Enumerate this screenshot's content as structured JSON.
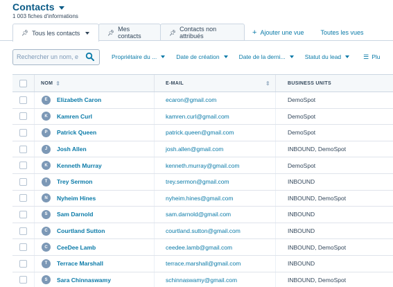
{
  "header": {
    "title": "Contacts",
    "subtitle": "1 003 fiches d'informations"
  },
  "tabs": [
    {
      "label": "Tous les contacts",
      "active": true
    },
    {
      "label": "Mes contacts",
      "active": false
    },
    {
      "label": "Contacts non attribués",
      "active": false
    }
  ],
  "tab_links": {
    "add_view": "Ajouter une vue",
    "all_views": "Toutes les vues"
  },
  "filters": {
    "search_placeholder": "Rechercher un nom, e",
    "owner": "Propriétaire du ...",
    "created": "Date de création",
    "last": "Date de la derni...",
    "lead_status": "Statut du lead",
    "more": "Plu"
  },
  "table": {
    "columns": [
      "NOM",
      "E-MAIL",
      "BUSINESS UNITS"
    ],
    "rows": [
      {
        "initial": "E",
        "name": "Elizabeth Caron",
        "email": "ecaron@gmail.com",
        "bu": "DemoSpot"
      },
      {
        "initial": "K",
        "name": "Kamren Curl",
        "email": "kamren.curl@gmail.com",
        "bu": "DemoSpot"
      },
      {
        "initial": "P",
        "name": "Patrick Queen",
        "email": "patrick.queen@gmail.com",
        "bu": "DemoSpot"
      },
      {
        "initial": "J",
        "name": "Josh Allen",
        "email": "josh.allen@gmail.com",
        "bu": "INBOUND, DemoSpot"
      },
      {
        "initial": "K",
        "name": "Kenneth Murray",
        "email": "kenneth.murray@gmail.com",
        "bu": "DemoSpot"
      },
      {
        "initial": "T",
        "name": "Trey Sermon",
        "email": "trey.sermon@gmail.com",
        "bu": "INBOUND"
      },
      {
        "initial": "N",
        "name": "Nyheim Hines",
        "email": "nyheim.hines@gmail.com",
        "bu": "INBOUND, DemoSpot"
      },
      {
        "initial": "S",
        "name": "Sam Darnold",
        "email": "sam.darnold@gmail.com",
        "bu": "INBOUND"
      },
      {
        "initial": "C",
        "name": "Courtland Sutton",
        "email": "courtland.sutton@gmail.com",
        "bu": "INBOUND"
      },
      {
        "initial": "C",
        "name": "CeeDee Lamb",
        "email": "ceedee.lamb@gmail.com",
        "bu": "INBOUND, DemoSpot"
      },
      {
        "initial": "T",
        "name": "Terrace Marshall",
        "email": "terrace.marshall@gmail.com",
        "bu": "INBOUND"
      },
      {
        "initial": "S",
        "name": "Sara Chinnaswamy",
        "email": "schinnaswamy@gmail.com",
        "bu": "INBOUND, DemoSpot"
      }
    ]
  },
  "colors": {
    "link": "#0a7aa8",
    "text": "#33475b",
    "avatar": "#7c98b6",
    "header_bg": "#f5f8fa"
  }
}
